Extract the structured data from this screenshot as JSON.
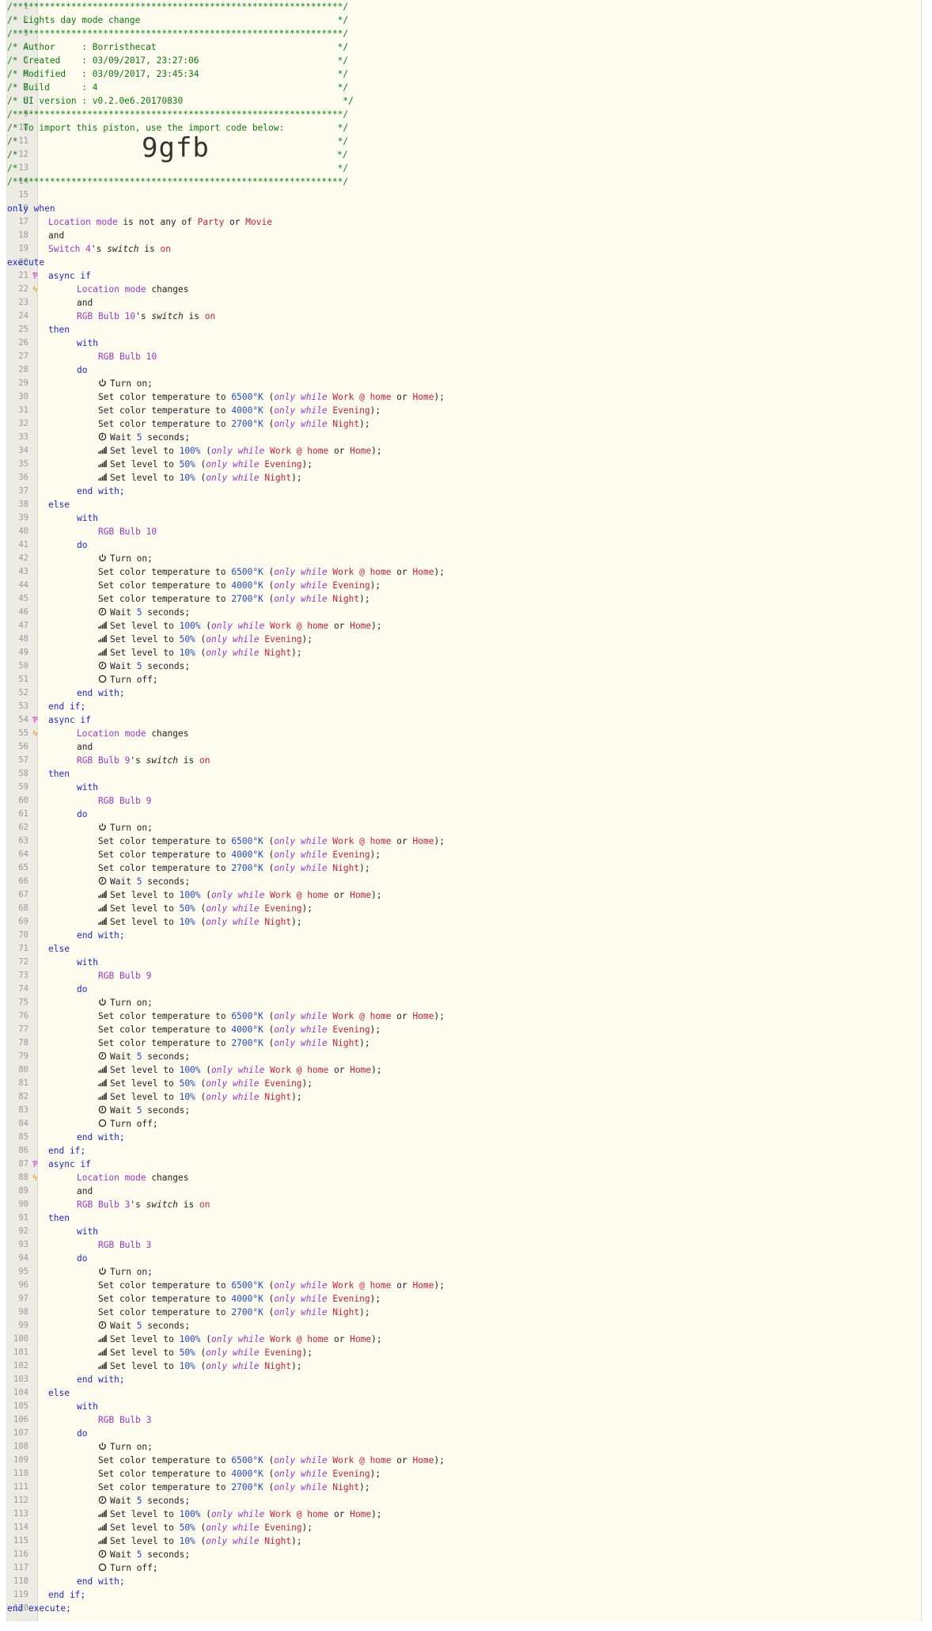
{
  "piston": {
    "comment_border": "/**************************************************************/",
    "name_line": "/* Lights day mode change                                     */",
    "author_line": "/* Author     : Borristhecat                                  */",
    "created_line": "/* Created    : 03/09/2017, 23:27:06                          */",
    "modified_line": "/* Modified   : 03/09/2017, 23:45:34                          */",
    "build_line": "/* Build      : 4                                             */",
    "ui_line": "/* UI version : v0.2.0e6.20170830                              */",
    "import_line": "/* To import this piston, use the import code below:          */",
    "blank_comment": "/*                                                            */",
    "import_prefix": "/*",
    "import_suffix": "*/",
    "import_code": "9gfb"
  },
  "keywords": {
    "only_when": "only when",
    "and": "and",
    "execute": "execute",
    "async_if": "async if",
    "then": "then",
    "with": "with",
    "do": "do",
    "end_with": "end with;",
    "else": "else",
    "end_if": "end if;",
    "end_execute": "end execute;"
  },
  "conditions": {
    "location_mode": "Location mode",
    "is_not_any_of": "is not any of",
    "party": "Party",
    "or": "or",
    "movie": "Movie",
    "switch4": "Switch 4",
    "switch_attr": "switch",
    "is": "is",
    "on": "on",
    "changes": "changes",
    "possessive": "'s"
  },
  "devices": [
    "RGB Bulb 10",
    "RGB Bulb 9",
    "RGB Bulb 3"
  ],
  "tasks": {
    "turn_on": "Turn on;",
    "turn_off": "Turn off;",
    "set_color_temp": "Set color temperature to",
    "set_level": "Set level to",
    "wait": "Wait",
    "seconds": "seconds;",
    "wait_value": "5",
    "only_while": "only while",
    "temp_6500": "6500°K",
    "temp_4000": "4000°K",
    "temp_2700": "2700°K",
    "level_100": "100%",
    "level_50": "50%",
    "level_10": "10%",
    "mode_work": "Work @ home",
    "mode_home": "Home",
    "mode_evening": "Evening",
    "mode_night": "Night"
  },
  "line_numbers": [
    1,
    2,
    3,
    4,
    5,
    6,
    7,
    8,
    9,
    10,
    11,
    12,
    13,
    14,
    15,
    16,
    17,
    18,
    19,
    20,
    21,
    22,
    23,
    24,
    25,
    26,
    27,
    28,
    29,
    30,
    31,
    32,
    33,
    34,
    35,
    36,
    37,
    38,
    39,
    40,
    41,
    42,
    43,
    44,
    45,
    46,
    47,
    48,
    49,
    50,
    51,
    52,
    53,
    54,
    55,
    56,
    57,
    58,
    59,
    60,
    61,
    62,
    63,
    64,
    65,
    66,
    67,
    68,
    69,
    70,
    71,
    72,
    73,
    74,
    75,
    76,
    77,
    78,
    79,
    80,
    81,
    82,
    83,
    84,
    85,
    86,
    87,
    88,
    89,
    90,
    91,
    92,
    93,
    94,
    95,
    96,
    97,
    98,
    99,
    100,
    101,
    102,
    103,
    104,
    105,
    106,
    107,
    108,
    109,
    110,
    111,
    112,
    113,
    114,
    115,
    116,
    117,
    118,
    119,
    120
  ],
  "colors": {
    "background": "#fdfcef",
    "comment": "#0a7d0a",
    "keyword": "#1d28c9",
    "device": "#9c36c5",
    "string": "#c81e3a",
    "number": "#2349c4"
  }
}
